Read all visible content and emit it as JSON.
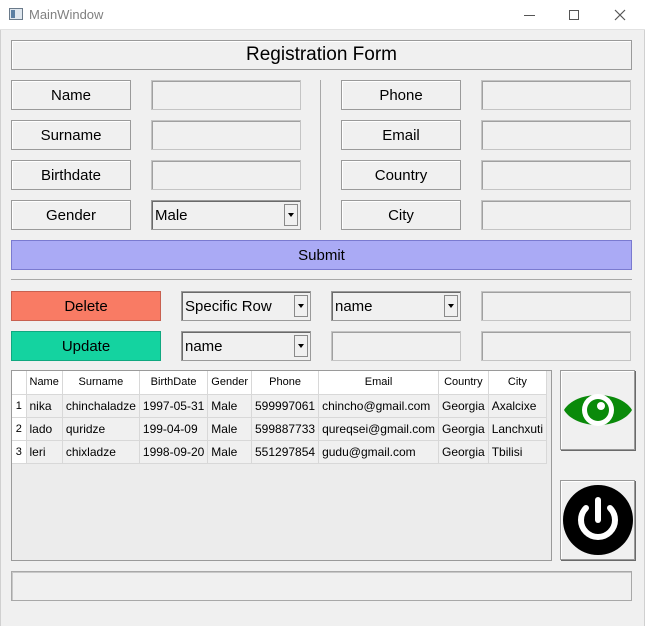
{
  "window": {
    "title": "MainWindow"
  },
  "form": {
    "title": "Registration Form",
    "left_labels": [
      "Name",
      "Surname",
      "Birthdate",
      "Gender"
    ],
    "right_labels": [
      "Phone",
      "Email",
      "Country",
      "City"
    ],
    "gender_value": "Male",
    "submit_label": "Submit"
  },
  "actions": {
    "delete_label": "Delete",
    "update_label": "Update",
    "delete_mode_value": "Specific Row",
    "delete_field_value": "name",
    "update_field_value": "name"
  },
  "table": {
    "headers": [
      "Name",
      "Surname",
      "BirthDate",
      "Gender",
      "Phone",
      "Email",
      "Country",
      "City"
    ],
    "rows": [
      {
        "num": "1",
        "cells": [
          "nika",
          "chinchaladze",
          "1997-05-31",
          "Male",
          "599997061",
          "chincho@gmail.com",
          "Georgia",
          "Axalcixe"
        ]
      },
      {
        "num": "2",
        "cells": [
          "lado",
          "quridze",
          "199-04-09",
          "Male",
          "599887733",
          "qureqsei@gmail.com",
          "Georgia",
          "Lanchxuti"
        ]
      },
      {
        "num": "3",
        "cells": [
          "leri",
          "chixladze",
          "1998-09-20",
          "Male",
          "551297854",
          "gudu@gmail.com",
          "Georgia",
          "Tbilisi"
        ]
      }
    ]
  },
  "icons": {
    "view": "eye-icon",
    "power": "power-icon",
    "view_color": "#0a8a0a",
    "power_color": "#000000"
  },
  "colors": {
    "submit_bg": "#aaaaf5",
    "delete_bg": "#f97b64",
    "update_bg": "#14d3a0"
  }
}
